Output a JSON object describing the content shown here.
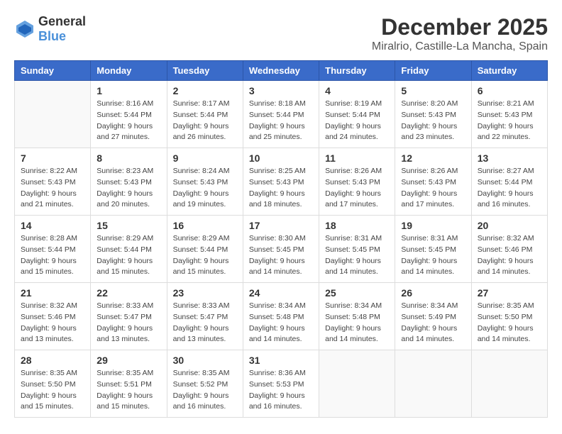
{
  "logo": {
    "text_general": "General",
    "text_blue": "Blue"
  },
  "title": "December 2025",
  "subtitle": "Miralrio, Castille-La Mancha, Spain",
  "days_of_week": [
    "Sunday",
    "Monday",
    "Tuesday",
    "Wednesday",
    "Thursday",
    "Friday",
    "Saturday"
  ],
  "weeks": [
    [
      {
        "day": "",
        "sunrise": "",
        "sunset": "",
        "daylight": ""
      },
      {
        "day": "1",
        "sunrise": "Sunrise: 8:16 AM",
        "sunset": "Sunset: 5:44 PM",
        "daylight": "Daylight: 9 hours and 27 minutes."
      },
      {
        "day": "2",
        "sunrise": "Sunrise: 8:17 AM",
        "sunset": "Sunset: 5:44 PM",
        "daylight": "Daylight: 9 hours and 26 minutes."
      },
      {
        "day": "3",
        "sunrise": "Sunrise: 8:18 AM",
        "sunset": "Sunset: 5:44 PM",
        "daylight": "Daylight: 9 hours and 25 minutes."
      },
      {
        "day": "4",
        "sunrise": "Sunrise: 8:19 AM",
        "sunset": "Sunset: 5:44 PM",
        "daylight": "Daylight: 9 hours and 24 minutes."
      },
      {
        "day": "5",
        "sunrise": "Sunrise: 8:20 AM",
        "sunset": "Sunset: 5:43 PM",
        "daylight": "Daylight: 9 hours and 23 minutes."
      },
      {
        "day": "6",
        "sunrise": "Sunrise: 8:21 AM",
        "sunset": "Sunset: 5:43 PM",
        "daylight": "Daylight: 9 hours and 22 minutes."
      }
    ],
    [
      {
        "day": "7",
        "sunrise": "Sunrise: 8:22 AM",
        "sunset": "Sunset: 5:43 PM",
        "daylight": "Daylight: 9 hours and 21 minutes."
      },
      {
        "day": "8",
        "sunrise": "Sunrise: 8:23 AM",
        "sunset": "Sunset: 5:43 PM",
        "daylight": "Daylight: 9 hours and 20 minutes."
      },
      {
        "day": "9",
        "sunrise": "Sunrise: 8:24 AM",
        "sunset": "Sunset: 5:43 PM",
        "daylight": "Daylight: 9 hours and 19 minutes."
      },
      {
        "day": "10",
        "sunrise": "Sunrise: 8:25 AM",
        "sunset": "Sunset: 5:43 PM",
        "daylight": "Daylight: 9 hours and 18 minutes."
      },
      {
        "day": "11",
        "sunrise": "Sunrise: 8:26 AM",
        "sunset": "Sunset: 5:43 PM",
        "daylight": "Daylight: 9 hours and 17 minutes."
      },
      {
        "day": "12",
        "sunrise": "Sunrise: 8:26 AM",
        "sunset": "Sunset: 5:43 PM",
        "daylight": "Daylight: 9 hours and 17 minutes."
      },
      {
        "day": "13",
        "sunrise": "Sunrise: 8:27 AM",
        "sunset": "Sunset: 5:44 PM",
        "daylight": "Daylight: 9 hours and 16 minutes."
      }
    ],
    [
      {
        "day": "14",
        "sunrise": "Sunrise: 8:28 AM",
        "sunset": "Sunset: 5:44 PM",
        "daylight": "Daylight: 9 hours and 15 minutes."
      },
      {
        "day": "15",
        "sunrise": "Sunrise: 8:29 AM",
        "sunset": "Sunset: 5:44 PM",
        "daylight": "Daylight: 9 hours and 15 minutes."
      },
      {
        "day": "16",
        "sunrise": "Sunrise: 8:29 AM",
        "sunset": "Sunset: 5:44 PM",
        "daylight": "Daylight: 9 hours and 15 minutes."
      },
      {
        "day": "17",
        "sunrise": "Sunrise: 8:30 AM",
        "sunset": "Sunset: 5:45 PM",
        "daylight": "Daylight: 9 hours and 14 minutes."
      },
      {
        "day": "18",
        "sunrise": "Sunrise: 8:31 AM",
        "sunset": "Sunset: 5:45 PM",
        "daylight": "Daylight: 9 hours and 14 minutes."
      },
      {
        "day": "19",
        "sunrise": "Sunrise: 8:31 AM",
        "sunset": "Sunset: 5:45 PM",
        "daylight": "Daylight: 9 hours and 14 minutes."
      },
      {
        "day": "20",
        "sunrise": "Sunrise: 8:32 AM",
        "sunset": "Sunset: 5:46 PM",
        "daylight": "Daylight: 9 hours and 14 minutes."
      }
    ],
    [
      {
        "day": "21",
        "sunrise": "Sunrise: 8:32 AM",
        "sunset": "Sunset: 5:46 PM",
        "daylight": "Daylight: 9 hours and 13 minutes."
      },
      {
        "day": "22",
        "sunrise": "Sunrise: 8:33 AM",
        "sunset": "Sunset: 5:47 PM",
        "daylight": "Daylight: 9 hours and 13 minutes."
      },
      {
        "day": "23",
        "sunrise": "Sunrise: 8:33 AM",
        "sunset": "Sunset: 5:47 PM",
        "daylight": "Daylight: 9 hours and 13 minutes."
      },
      {
        "day": "24",
        "sunrise": "Sunrise: 8:34 AM",
        "sunset": "Sunset: 5:48 PM",
        "daylight": "Daylight: 9 hours and 14 minutes."
      },
      {
        "day": "25",
        "sunrise": "Sunrise: 8:34 AM",
        "sunset": "Sunset: 5:48 PM",
        "daylight": "Daylight: 9 hours and 14 minutes."
      },
      {
        "day": "26",
        "sunrise": "Sunrise: 8:34 AM",
        "sunset": "Sunset: 5:49 PM",
        "daylight": "Daylight: 9 hours and 14 minutes."
      },
      {
        "day": "27",
        "sunrise": "Sunrise: 8:35 AM",
        "sunset": "Sunset: 5:50 PM",
        "daylight": "Daylight: 9 hours and 14 minutes."
      }
    ],
    [
      {
        "day": "28",
        "sunrise": "Sunrise: 8:35 AM",
        "sunset": "Sunset: 5:50 PM",
        "daylight": "Daylight: 9 hours and 15 minutes."
      },
      {
        "day": "29",
        "sunrise": "Sunrise: 8:35 AM",
        "sunset": "Sunset: 5:51 PM",
        "daylight": "Daylight: 9 hours and 15 minutes."
      },
      {
        "day": "30",
        "sunrise": "Sunrise: 8:35 AM",
        "sunset": "Sunset: 5:52 PM",
        "daylight": "Daylight: 9 hours and 16 minutes."
      },
      {
        "day": "31",
        "sunrise": "Sunrise: 8:36 AM",
        "sunset": "Sunset: 5:53 PM",
        "daylight": "Daylight: 9 hours and 16 minutes."
      },
      {
        "day": "",
        "sunrise": "",
        "sunset": "",
        "daylight": ""
      },
      {
        "day": "",
        "sunrise": "",
        "sunset": "",
        "daylight": ""
      },
      {
        "day": "",
        "sunrise": "",
        "sunset": "",
        "daylight": ""
      }
    ]
  ]
}
